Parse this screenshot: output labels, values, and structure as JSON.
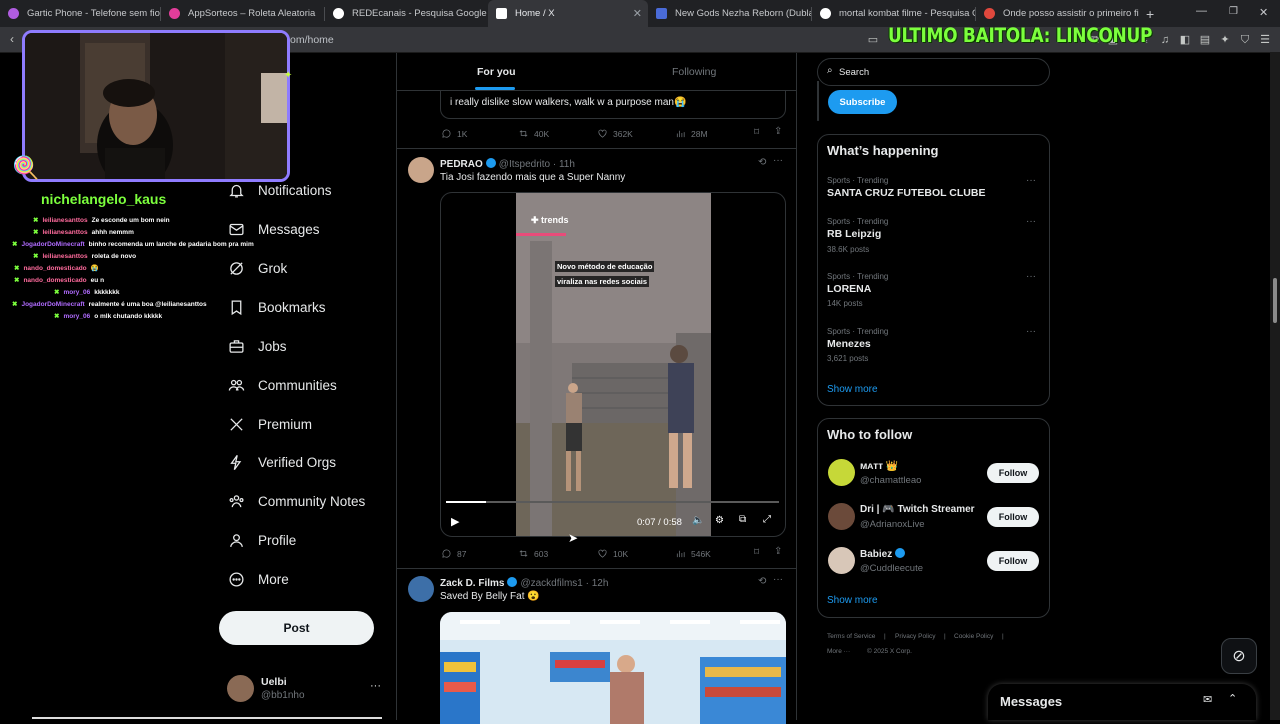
{
  "browser": {
    "tabs": [
      {
        "label": "Gartic Phone - Telefone sem fio",
        "color": "#b05ce0"
      },
      {
        "label": "AppSorteos – Roleta Aleatoria",
        "color": "#e23d9a"
      },
      {
        "label": "REDEcanais - Pesquisa Google",
        "color": "#ffffff"
      },
      {
        "label": "Home / X",
        "color": "#ffffff"
      },
      {
        "label": "New Gods Nezha Reborn (Dublado)",
        "color": "#4a6bd8"
      },
      {
        "label": "mortal kombat filme - Pesquisa Goo",
        "color": "#ffffff"
      },
      {
        "label": "Onde posso assistir o primeiro filme",
        "color": "#e0483d"
      }
    ],
    "url": "om/home",
    "overlay_banner": "ULTIMO BAITOLA: LINCONUP"
  },
  "stream": {
    "streamer_name": "nichelangelo_kaus",
    "chat": [
      {
        "user": "leilianesanttos",
        "msg": "Ze esconde um bom nein",
        "color": "#ff6b9d"
      },
      {
        "user": "leilianesanttos",
        "msg": "ahhh nemmm",
        "color": "#ff6b9d"
      },
      {
        "user": "JogadorDoMinecraft",
        "msg": "binho recomenda um lanche de padaria bom pra mim",
        "color": "#b06bff"
      },
      {
        "user": "leilianesanttos",
        "msg": "roleta de novo",
        "color": "#ff6b9d"
      },
      {
        "user": "nando_domesticado",
        "msg": "😭",
        "color": "#ff6b9d"
      },
      {
        "user": "nando_domesticado",
        "msg": "eu n",
        "color": "#ff6b9d"
      },
      {
        "user": "mory_06",
        "msg": "kkkkkkk",
        "color": "#b06bff"
      },
      {
        "user": "JogadorDoMinecraft",
        "msg": "realmente é uma boa @leilianesanttos",
        "color": "#b06bff"
      },
      {
        "user": "mory_06",
        "msg": "o mlk chutando kkkkk",
        "color": "#b06bff"
      }
    ]
  },
  "nav": {
    "items": [
      {
        "label": "Notifications",
        "icon": "bell-icon"
      },
      {
        "label": "Messages",
        "icon": "envelope-icon"
      },
      {
        "label": "Grok",
        "icon": "grok-icon"
      },
      {
        "label": "Bookmarks",
        "icon": "bookmark-icon"
      },
      {
        "label": "Jobs",
        "icon": "briefcase-icon"
      },
      {
        "label": "Communities",
        "icon": "people-icon"
      },
      {
        "label": "Premium",
        "icon": "x-logo-icon"
      },
      {
        "label": "Verified Orgs",
        "icon": "lightning-icon"
      },
      {
        "label": "Community Notes",
        "icon": "community-notes-icon"
      },
      {
        "label": "Profile",
        "icon": "person-icon"
      },
      {
        "label": "More",
        "icon": "more-circle-icon"
      }
    ],
    "post_label": "Post",
    "account": {
      "name": "Uelbi",
      "handle": "@bb1nho"
    }
  },
  "feed": {
    "tabs": [
      "For you",
      "Following"
    ],
    "tweets": [
      {
        "text": "i really dislike slow walkers, walk w a purpose man😭",
        "replies": "1K",
        "retweets": "40K",
        "likes": "362K",
        "views": "28M"
      },
      {
        "name": "PEDRAO",
        "handle": "@Itspedrito",
        "time": "11h",
        "text": "Tia Josi fazendo mais que a Super Nanny",
        "video": {
          "watermark": "trends",
          "caption_line1": "Novo método de educação",
          "caption_line2": "viraliza nas redes sociais",
          "time": "0:07 / 0:58",
          "progress": 0.12
        },
        "replies": "87",
        "retweets": "603",
        "likes": "10K",
        "views": "546K"
      },
      {
        "name": "Zack D. Films",
        "handle": "@zackdfilms1",
        "time": "12h",
        "text": "Saved By Belly Fat 😮"
      }
    ]
  },
  "sidebar": {
    "search_placeholder": "Search",
    "subscribe_label": "Subscribe",
    "happening_title": "What’s happening",
    "trends": [
      {
        "category": "Sports · Trending",
        "name": "SANTA CRUZ FUTEBOL CLUBE",
        "posts": ""
      },
      {
        "category": "Sports · Trending",
        "name": "RB Leipzig",
        "posts": "38.6K posts"
      },
      {
        "category": "Sports · Trending",
        "name": "LORENA",
        "posts": "14K posts"
      },
      {
        "category": "Sports · Trending",
        "name": "Menezes",
        "posts": "3,621 posts"
      }
    ],
    "show_more": "Show more",
    "who_to_follow_title": "Who to follow",
    "follow_suggestions": [
      {
        "name": "ᴍᴀᴛᴛ 👑",
        "handle": "@chamattleao",
        "avatar_color": "#c6d838"
      },
      {
        "name": "Dri | 🎮 Twitch Streamer",
        "handle": "@AdrianoxLive",
        "avatar_color": "#6b4a3a"
      },
      {
        "name": "Babiez",
        "handle": "@Cuddleecute",
        "avatar_color": "#d8c7b8"
      }
    ],
    "follow_label": "Follow",
    "footer": [
      "Terms of Service",
      "Privacy Policy",
      "Cookie Policy",
      "More ···",
      "© 2025 X Corp."
    ],
    "messages_label": "Messages"
  }
}
